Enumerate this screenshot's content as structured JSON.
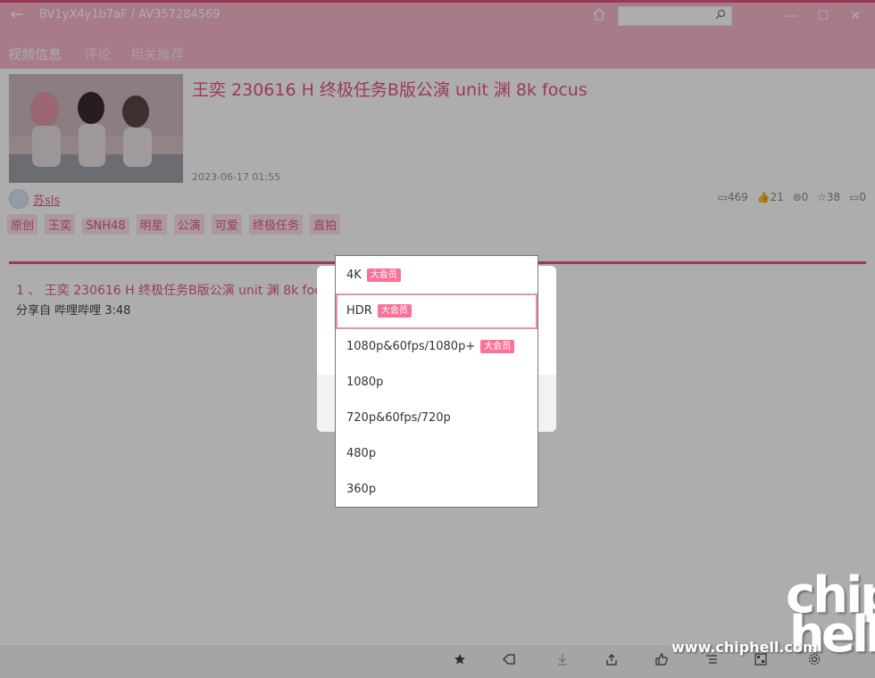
{
  "window": {
    "back_glyph": "←",
    "title": "BV1yX4y1b7aF / AV357284569",
    "search_placeholder": "",
    "minimize_glyph": "—",
    "maximize_glyph": "☐",
    "close_glyph": "✕"
  },
  "nav": {
    "tabs": [
      {
        "label": "视频信息"
      },
      {
        "label": "评论"
      },
      {
        "label": "相关推荐"
      }
    ]
  },
  "video": {
    "title": "王奕 230616 H 终极任务B版公演 unit 渊 8k focus",
    "publish_time": "2023-06-17 01:55",
    "uploader": "苏sls",
    "stats": {
      "views": "469",
      "likes": "21",
      "coins": "0",
      "favorites": "38",
      "comments": "0"
    },
    "tags": [
      "原创",
      "王奕",
      "SNH48",
      "明星",
      "公演",
      "可爱",
      "终极任务",
      "直拍"
    ]
  },
  "parts": [
    {
      "label": "1 、 王奕 230616 H 终极任务B版公演 unit 渊 8k focus",
      "desc": "分享自 哔哩哔哩 3:48"
    }
  ],
  "quality_dropdown": {
    "options": [
      {
        "label": "4K",
        "badge": "大会员"
      },
      {
        "label": "HDR",
        "badge": "大会员",
        "selected": true
      },
      {
        "label": "1080p&60fps/1080p+",
        "badge": "大会员"
      },
      {
        "label": "1080p"
      },
      {
        "label": "720p&60fps/720p"
      },
      {
        "label": "480p"
      },
      {
        "label": "360p"
      }
    ]
  },
  "watermark": {
    "site": "www.chiphell.com",
    "logo_line1": "chip",
    "logo_line2": "hell"
  },
  "colors": {
    "accent": "#e4567e",
    "header_bg": "#f6b5c8",
    "badge": "#fb7299"
  }
}
